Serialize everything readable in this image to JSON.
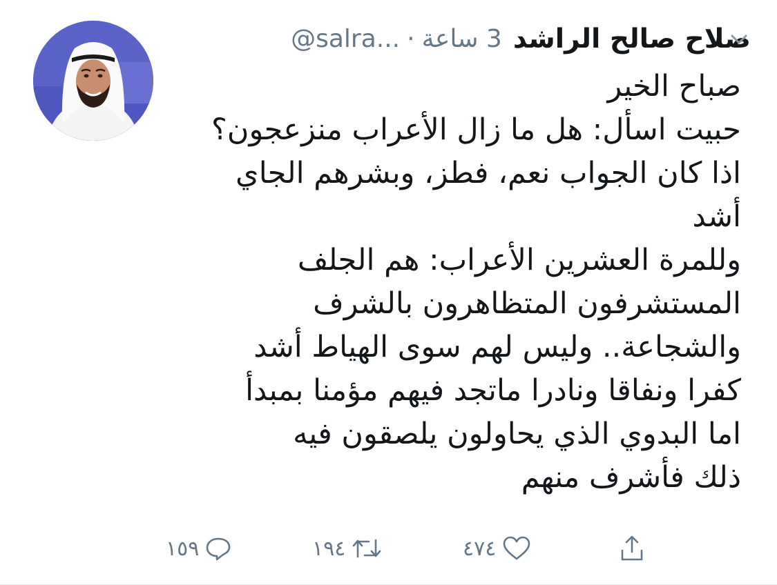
{
  "tweet": {
    "display_name": "صلاح صالح الراشد",
    "handle": "@salra...",
    "separator": "·",
    "time": "3 ساعة",
    "body_lines": [
      "صباح الخير",
      "حبيت اسأل: هل ما زال الأعراب منزعجون؟",
      "اذا كان الجواب نعم، فطز، وبشرهم الجاي",
      "أشد",
      "وللمرة العشرين الأعراب: هم الجلف",
      "المستشرفون المتظاهرون بالشرف",
      "والشجاعة.. وليس لهم سوى الهياط أشد",
      "كفرا ونفاقا ونادرا ماتجد فيهم مؤمنا بمبدأ",
      "اما البدوي الذي يحاولون يلصقون فيه",
      "ذلك فأشرف منهم"
    ]
  },
  "actions": {
    "reply_count": "١٥٩",
    "retweet_count": "١٩٤",
    "like_count": "٤٧٤"
  },
  "icons": {
    "avatar": "profile-photo",
    "menu": "chevron-down-icon",
    "reply": "reply-bubble-icon",
    "retweet": "retweet-icon",
    "like": "heart-icon",
    "share": "share-upload-icon"
  },
  "colors": {
    "text": "#14171a",
    "muted": "#657786",
    "avatar_bg": "#5b62c8"
  }
}
